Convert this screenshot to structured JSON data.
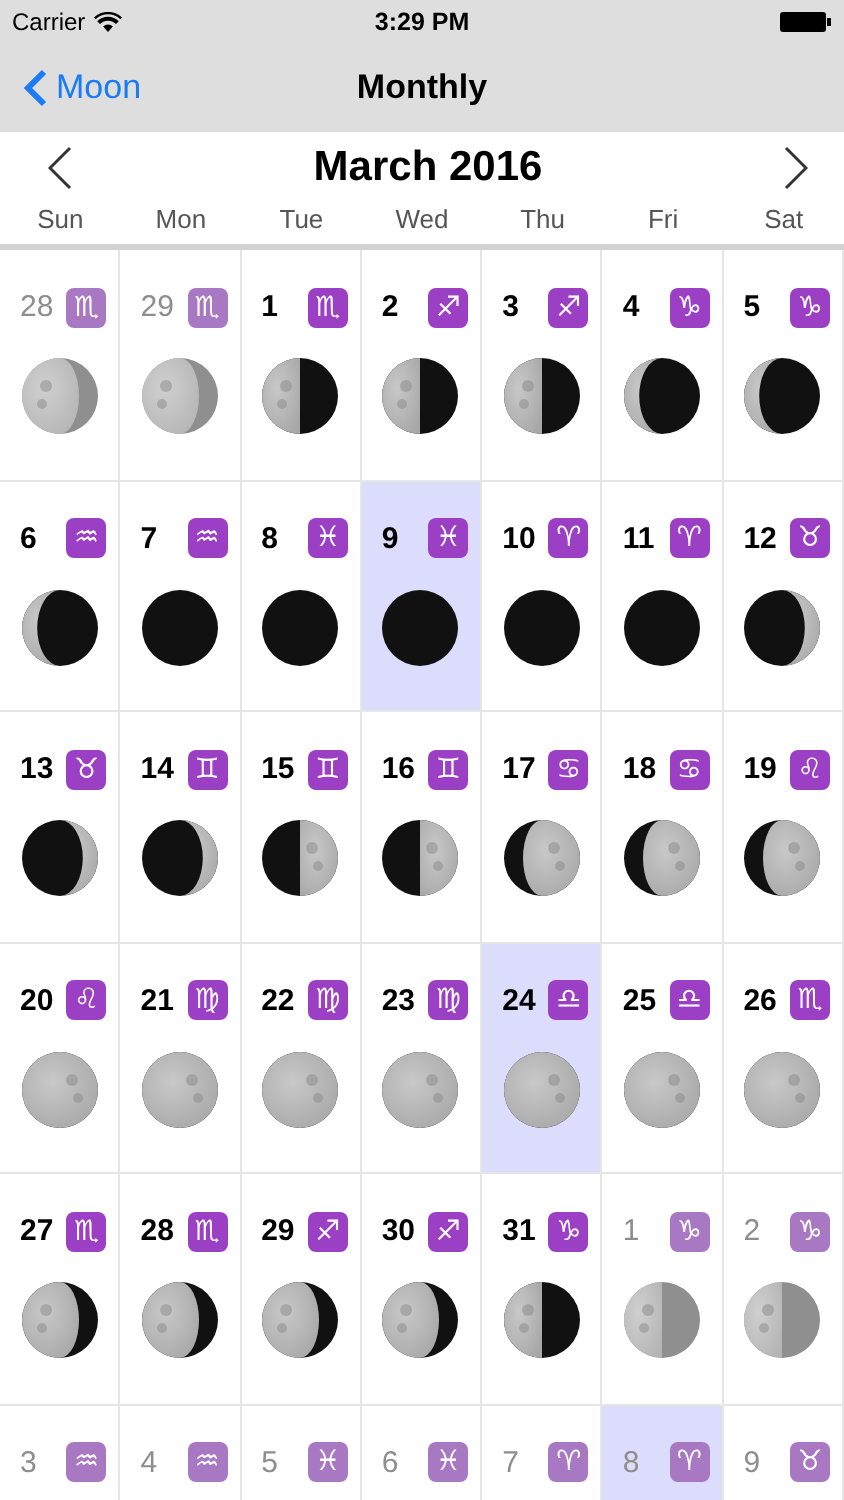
{
  "status_bar": {
    "carrier": "Carrier",
    "time": "3:29 PM"
  },
  "nav": {
    "back": "Moon",
    "title": "Monthly"
  },
  "calendar": {
    "month": "March 2016",
    "weekdays": [
      "Sun",
      "Mon",
      "Tue",
      "Wed",
      "Thu",
      "Fri",
      "Sat"
    ],
    "days": [
      {
        "day": "28",
        "sign": "♏",
        "in_month": false,
        "highlighted": false,
        "kind": "waning_gibbous"
      },
      {
        "day": "29",
        "sign": "♏",
        "in_month": false,
        "highlighted": false,
        "kind": "waning_gibbous"
      },
      {
        "day": "1",
        "sign": "♏",
        "in_month": true,
        "highlighted": false,
        "kind": "last_quarter"
      },
      {
        "day": "2",
        "sign": "♐",
        "in_month": true,
        "highlighted": false,
        "kind": "last_quarter"
      },
      {
        "day": "3",
        "sign": "♐",
        "in_month": true,
        "highlighted": false,
        "kind": "last_quarter"
      },
      {
        "day": "4",
        "sign": "♑",
        "in_month": true,
        "highlighted": false,
        "kind": "waning_crescent"
      },
      {
        "day": "5",
        "sign": "♑",
        "in_month": true,
        "highlighted": false,
        "kind": "waning_crescent"
      },
      {
        "day": "6",
        "sign": "♒",
        "in_month": true,
        "highlighted": false,
        "kind": "waning_crescent"
      },
      {
        "day": "7",
        "sign": "♒",
        "in_month": true,
        "highlighted": false,
        "kind": "new"
      },
      {
        "day": "8",
        "sign": "♓",
        "in_month": true,
        "highlighted": false,
        "kind": "new"
      },
      {
        "day": "9",
        "sign": "♓",
        "in_month": true,
        "highlighted": true,
        "kind": "new"
      },
      {
        "day": "10",
        "sign": "♈",
        "in_month": true,
        "highlighted": false,
        "kind": "new"
      },
      {
        "day": "11",
        "sign": "♈",
        "in_month": true,
        "highlighted": false,
        "kind": "new"
      },
      {
        "day": "12",
        "sign": "♉",
        "in_month": true,
        "highlighted": false,
        "kind": "waxing_crescent"
      },
      {
        "day": "13",
        "sign": "♉",
        "in_month": true,
        "highlighted": false,
        "kind": "waxing_crescent"
      },
      {
        "day": "14",
        "sign": "♊",
        "in_month": true,
        "highlighted": false,
        "kind": "waxing_crescent"
      },
      {
        "day": "15",
        "sign": "♊",
        "in_month": true,
        "highlighted": false,
        "kind": "first_quarter"
      },
      {
        "day": "16",
        "sign": "♊",
        "in_month": true,
        "highlighted": false,
        "kind": "first_quarter"
      },
      {
        "day": "17",
        "sign": "♋",
        "in_month": true,
        "highlighted": false,
        "kind": "waxing_gibbous"
      },
      {
        "day": "18",
        "sign": "♋",
        "in_month": true,
        "highlighted": false,
        "kind": "waxing_gibbous"
      },
      {
        "day": "19",
        "sign": "♌",
        "in_month": true,
        "highlighted": false,
        "kind": "waxing_gibbous"
      },
      {
        "day": "20",
        "sign": "♌",
        "in_month": true,
        "highlighted": false,
        "kind": "full"
      },
      {
        "day": "21",
        "sign": "♍",
        "in_month": true,
        "highlighted": false,
        "kind": "full"
      },
      {
        "day": "22",
        "sign": "♍",
        "in_month": true,
        "highlighted": false,
        "kind": "full"
      },
      {
        "day": "23",
        "sign": "♍",
        "in_month": true,
        "highlighted": false,
        "kind": "full"
      },
      {
        "day": "24",
        "sign": "♎",
        "in_month": true,
        "highlighted": true,
        "kind": "full"
      },
      {
        "day": "25",
        "sign": "♎",
        "in_month": true,
        "highlighted": false,
        "kind": "full"
      },
      {
        "day": "26",
        "sign": "♏",
        "in_month": true,
        "highlighted": false,
        "kind": "full"
      },
      {
        "day": "27",
        "sign": "♏",
        "in_month": true,
        "highlighted": false,
        "kind": "waning_gibbous"
      },
      {
        "day": "28",
        "sign": "♏",
        "in_month": true,
        "highlighted": false,
        "kind": "waning_gibbous"
      },
      {
        "day": "29",
        "sign": "♐",
        "in_month": true,
        "highlighted": false,
        "kind": "waning_gibbous"
      },
      {
        "day": "30",
        "sign": "♐",
        "in_month": true,
        "highlighted": false,
        "kind": "waning_gibbous"
      },
      {
        "day": "31",
        "sign": "♑",
        "in_month": true,
        "highlighted": false,
        "kind": "last_quarter"
      },
      {
        "day": "1",
        "sign": "♑",
        "in_month": false,
        "highlighted": false,
        "kind": "last_quarter"
      },
      {
        "day": "2",
        "sign": "♑",
        "in_month": false,
        "highlighted": false,
        "kind": "last_quarter"
      },
      {
        "day": "3",
        "sign": "♒",
        "in_month": false,
        "highlighted": false
      },
      {
        "day": "4",
        "sign": "♒",
        "in_month": false,
        "highlighted": false
      },
      {
        "day": "5",
        "sign": "♓",
        "in_month": false,
        "highlighted": false
      },
      {
        "day": "6",
        "sign": "♓",
        "in_month": false,
        "highlighted": false
      },
      {
        "day": "7",
        "sign": "♈",
        "in_month": false,
        "highlighted": false
      },
      {
        "day": "8",
        "sign": "♈",
        "in_month": false,
        "highlighted": true
      },
      {
        "day": "9",
        "sign": "♉",
        "in_month": false,
        "highlighted": false
      }
    ]
  }
}
